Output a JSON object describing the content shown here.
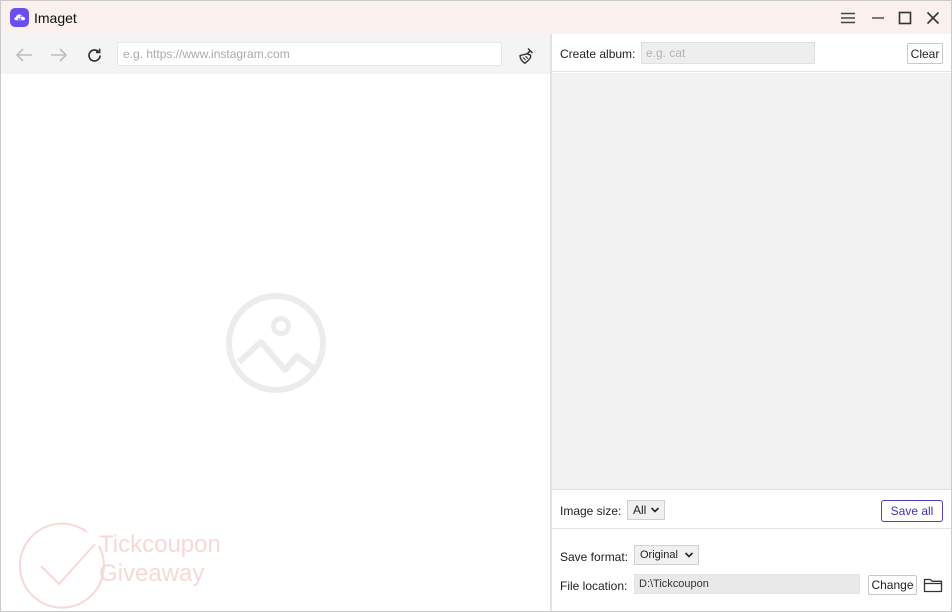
{
  "app": {
    "title": "Imaget",
    "logo_icon": "imaget-logo-icon",
    "accent_color": "#6a4ff0"
  },
  "window_controls": {
    "menu_icon": "hamburger-menu-icon",
    "minimize_icon": "minimize-icon",
    "maximize_icon": "maximize-icon",
    "close_icon": "close-icon"
  },
  "browser": {
    "back_icon": "arrow-left-icon",
    "forward_icon": "arrow-right-icon",
    "reload_icon": "reload-icon",
    "clean_icon": "broom-icon",
    "url_value": "",
    "url_placeholder": "e.g. https://www.instagram.com",
    "empty_state_icon": "image-placeholder-icon"
  },
  "watermark": {
    "line1": "Tickcoupon",
    "line2": "Giveaway",
    "color": "#f4b8b8"
  },
  "album": {
    "label": "Create album:",
    "input_value": "",
    "input_placeholder": "e.g. cat",
    "clear_label": "Clear"
  },
  "filters": {
    "image_size_label": "Image size:",
    "image_size_value": "All",
    "save_all_label": "Save all",
    "save_all_color": "#4a41c7"
  },
  "output": {
    "save_format_label": "Save format:",
    "save_format_value": "Original",
    "file_location_label": "File location:",
    "file_location_value": "D:\\Tickcoupon",
    "change_label": "Change",
    "folder_icon": "folder-icon"
  }
}
